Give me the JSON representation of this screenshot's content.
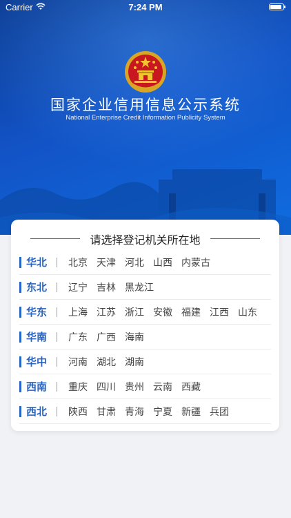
{
  "status_bar": {
    "carrier": "Carrier",
    "time": "7:24 PM"
  },
  "header": {
    "title": "国家企业信用信息公示系统",
    "subtitle": "National Enterprise Credit Information Publicity System"
  },
  "card": {
    "title": "请选择登记机关所在地",
    "regions": [
      {
        "name": "华北",
        "provinces": [
          "北京",
          "天津",
          "河北",
          "山西",
          "内蒙古"
        ]
      },
      {
        "name": "东北",
        "provinces": [
          "辽宁",
          "吉林",
          "黑龙江"
        ]
      },
      {
        "name": "华东",
        "provinces": [
          "上海",
          "江苏",
          "浙江",
          "安徽",
          "福建",
          "江西",
          "山东"
        ]
      },
      {
        "name": "华南",
        "provinces": [
          "广东",
          "广西",
          "海南"
        ]
      },
      {
        "name": "华中",
        "provinces": [
          "河南",
          "湖北",
          "湖南"
        ]
      },
      {
        "name": "西南",
        "provinces": [
          "重庆",
          "四川",
          "贵州",
          "云南",
          "西藏"
        ]
      },
      {
        "name": "西北",
        "provinces": [
          "陕西",
          "甘肃",
          "青海",
          "宁夏",
          "新疆",
          "兵团"
        ]
      }
    ]
  },
  "colors": {
    "accent": "#2a64bf",
    "banner_top": "#0c3c93",
    "banner_bottom": "#0f6de0"
  },
  "icons": {
    "emblem": "national-emblem-icon",
    "wifi": "wifi-icon",
    "battery": "battery-icon"
  }
}
